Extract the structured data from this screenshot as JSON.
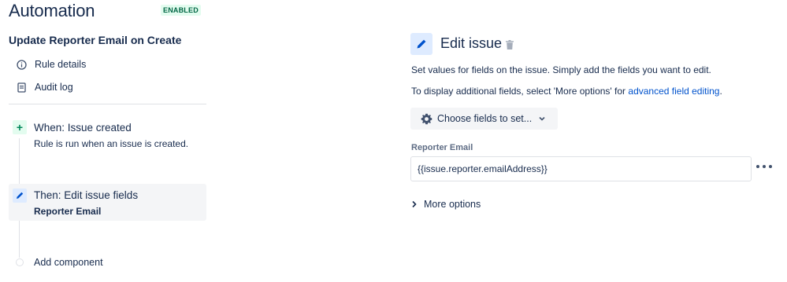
{
  "header": {
    "title": "Automation",
    "status_badge": "ENABLED"
  },
  "rule": {
    "name": "Update Reporter Email on Create",
    "nav": [
      {
        "label": "Rule details",
        "icon": "info-icon"
      },
      {
        "label": "Audit log",
        "icon": "document-icon"
      }
    ]
  },
  "timeline": {
    "trigger": {
      "title": "When: Issue created",
      "description": "Rule is run when an issue is created."
    },
    "action": {
      "title": "Then: Edit issue fields",
      "subtitle": "Reporter Email"
    },
    "add_component": "Add component"
  },
  "panel": {
    "title": "Edit issue",
    "description": "Set values for fields on the issue. Simply add the fields you want to edit.",
    "more_info_prefix": "To display additional fields, select 'More options' for ",
    "more_info_link": "advanced field editing",
    "more_info_suffix": ".",
    "choose_fields_button": "Choose fields to set...",
    "field": {
      "label": "Reporter Email",
      "value": "{{issue.reporter.emailAddress}}"
    },
    "more_options": "More options"
  },
  "colors": {
    "accent": "#0052cc",
    "enabled_bg": "#e3fcef",
    "enabled_text": "#006644",
    "trigger_icon": "#00875a",
    "action_bg": "#deebff"
  }
}
